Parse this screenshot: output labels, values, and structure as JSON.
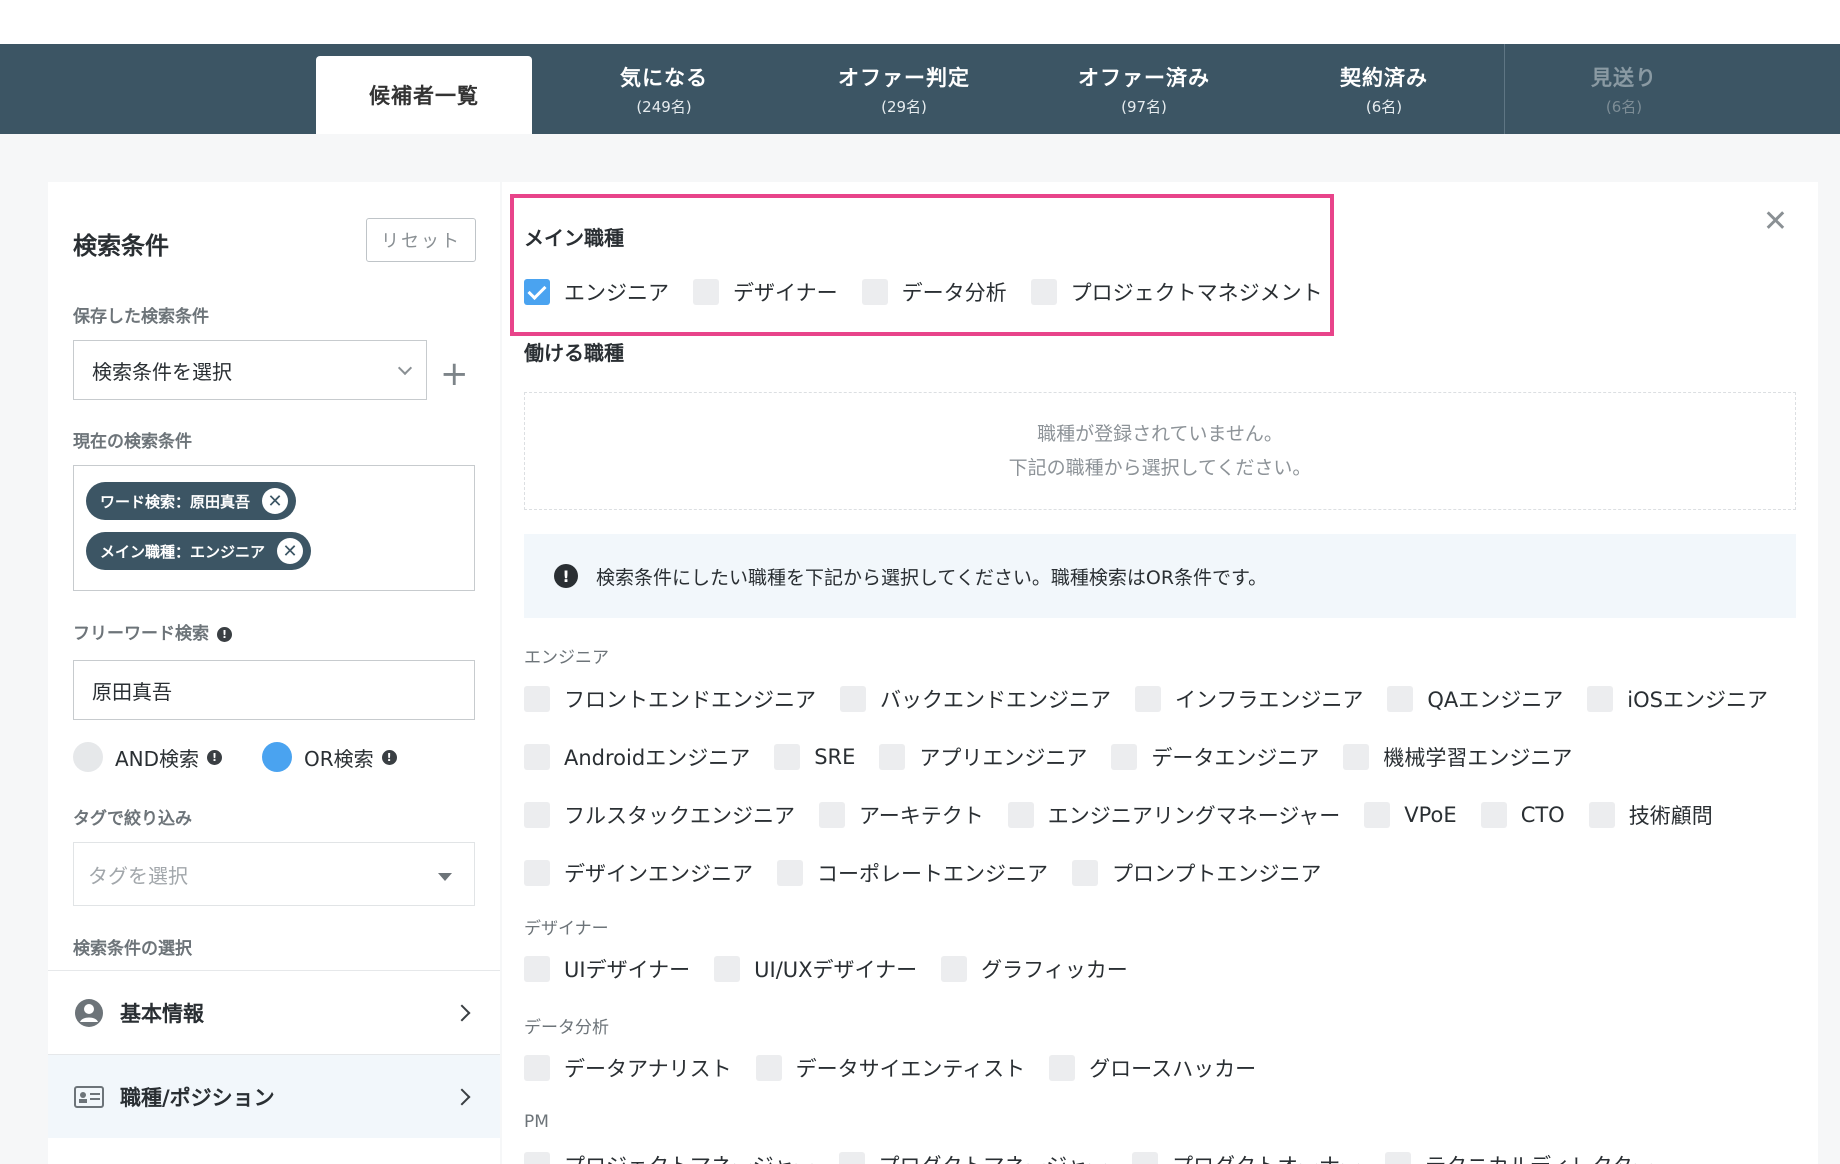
{
  "tabs": [
    {
      "label": "候補者一覧",
      "count": ""
    },
    {
      "label": "気になる",
      "count": "(249名)"
    },
    {
      "label": "オファー判定",
      "count": "(29名)"
    },
    {
      "label": "オファー済み",
      "count": "(97名)"
    },
    {
      "label": "契約済み",
      "count": "(6名)"
    },
    {
      "label": "見送り",
      "count": "(6名)"
    }
  ],
  "left": {
    "title": "検索条件",
    "reset_label": "リセット",
    "saved_label": "保存した検索条件",
    "saved_select": "検索条件を選択",
    "current_label": "現在の検索条件",
    "chips": [
      "ワード検索：原田真吾",
      "メイン職種：エンジニア"
    ],
    "freeword_label": "フリーワード検索",
    "freeword_value": "原田真吾",
    "and_label": "AND検索",
    "or_label": "OR検索",
    "tag_label": "タグで絞り込み",
    "tag_placeholder": "タグを選択",
    "select_cond_label": "検索条件の選択",
    "nav": [
      {
        "label": "基本情報",
        "icon": "user-circle-icon"
      },
      {
        "label": "職種/ポジション",
        "icon": "id-card-icon"
      }
    ]
  },
  "right": {
    "main_title": "メイン職種",
    "main_options": [
      {
        "label": "エンジニア",
        "checked": true
      },
      {
        "label": "デザイナー",
        "checked": false
      },
      {
        "label": "データ分析",
        "checked": false
      },
      {
        "label": "プロジェクトマネジメント",
        "checked": false
      }
    ],
    "work_title": "働ける職種",
    "empty_line1": "職種が登録されていません。",
    "empty_line2": "下記の職種から選択してください。",
    "notice": "検索条件にしたい職種を下記から選択してください。職種検索はOR条件です。",
    "categories": [
      {
        "label": "エンジニア",
        "rows": [
          [
            "フロントエンドエンジニア",
            "バックエンドエンジニア",
            "インフラエンジニア",
            "QAエンジニア",
            "iOSエンジニア"
          ],
          [
            "Androidエンジニア",
            "SRE",
            "アプリエンジニア",
            "データエンジニア",
            "機械学習エンジニア"
          ],
          [
            "フルスタックエンジニア",
            "アーキテクト",
            "エンジニアリングマネージャー",
            "VPoE",
            "CTO",
            "技術顧問"
          ],
          [
            "デザインエンジニア",
            "コーポレートエンジニア",
            "プロンプトエンジニア"
          ]
        ]
      },
      {
        "label": "デザイナー",
        "rows": [
          [
            "UIデザイナー",
            "UI/UXデザイナー",
            "グラフィッカー"
          ]
        ]
      },
      {
        "label": "データ分析",
        "rows": [
          [
            "データアナリスト",
            "データサイエンティスト",
            "グロースハッカー"
          ]
        ]
      },
      {
        "label": "PM",
        "rows": [
          [
            "プロジェクトマネージャー",
            "プロダクトマネージャー",
            "プロダクトオーナー",
            "テクニカルディレクター"
          ]
        ]
      }
    ]
  },
  "colors": {
    "nav_bg": "#3c5564",
    "accent": "#4aa3f0",
    "highlight": "#e8448a"
  }
}
